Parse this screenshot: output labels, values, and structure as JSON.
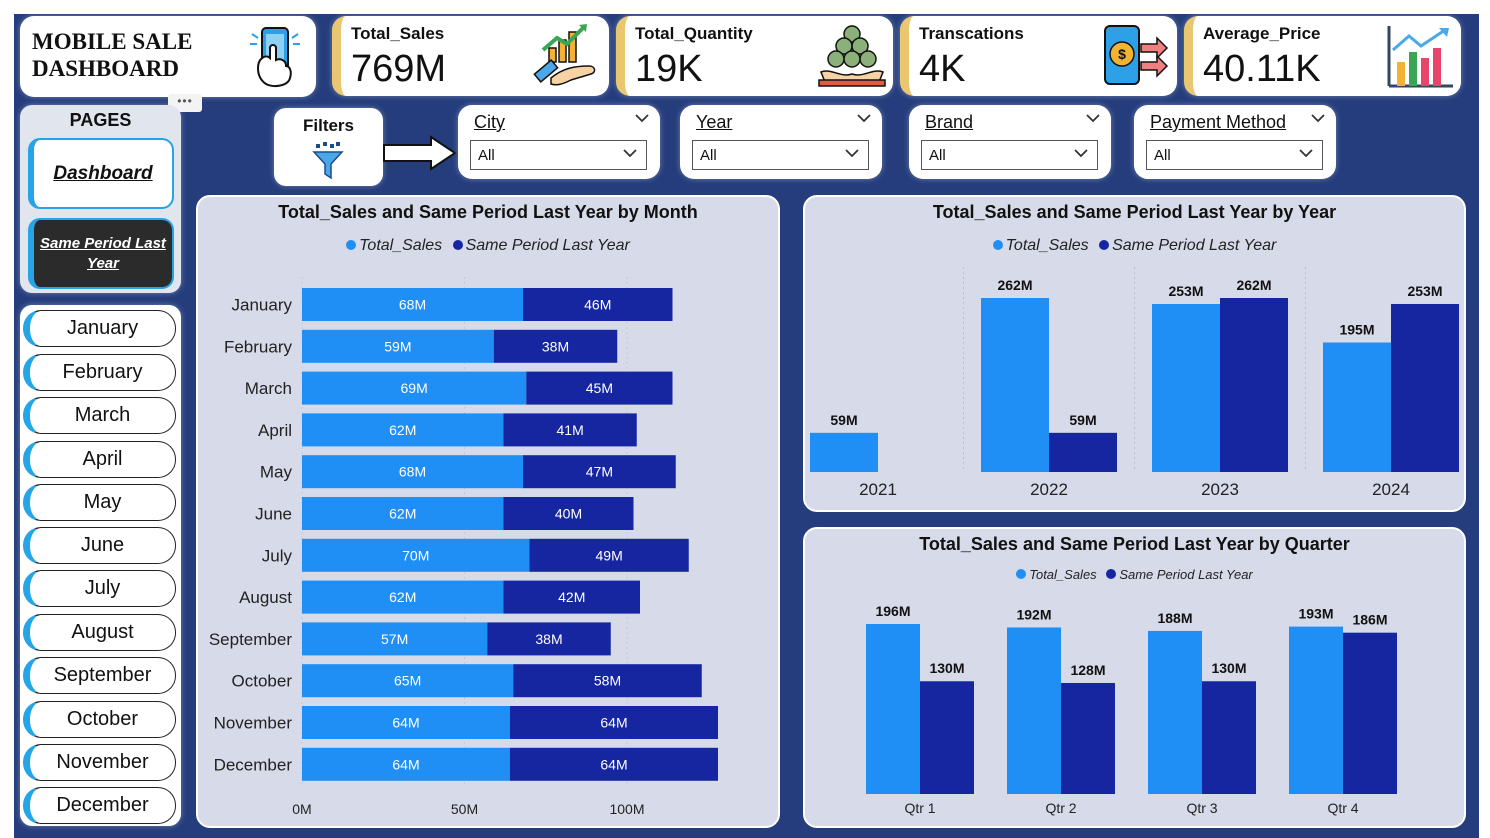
{
  "dashboard": {
    "title_line1": "MOBILE SALE",
    "title_line2": "DASHBOARD",
    "more_options": "•••"
  },
  "kpis": [
    {
      "label": "Total_Sales",
      "value": "769M",
      "icon": "money-growth-icon"
    },
    {
      "label": "Total_Quantity",
      "value": "19K",
      "icon": "coin-stack-icon"
    },
    {
      "label": "Transcations",
      "value": "4K",
      "icon": "phone-payment-icon"
    },
    {
      "label": "Average_Price",
      "value": "40.11K",
      "icon": "bar-chart-icon"
    }
  ],
  "pages": {
    "title": "PAGES",
    "dashboard_label": "Dashboard",
    "spl_label_line1": "Same Period Last",
    "spl_label_line2": "Year"
  },
  "months": [
    "January",
    "February",
    "March",
    "April",
    "May",
    "June",
    "July",
    "August",
    "September",
    "October",
    "November",
    "December"
  ],
  "filters": {
    "label": "Filters",
    "slicers": [
      {
        "label": "City",
        "value": "All"
      },
      {
        "label": "Year",
        "value": "All"
      },
      {
        "label": "Brand",
        "value": "All"
      },
      {
        "label": "Payment Method",
        "value": "All"
      }
    ]
  },
  "colors": {
    "background": "#253d7c",
    "panel": "#d7dbe9",
    "total_sales": "#1f8ff5",
    "same_period": "#1526a0",
    "accent": "#25a4e6",
    "kpi_border": "#e8c770"
  },
  "chart_data": [
    {
      "type": "bar",
      "orientation": "horizontal-stacked",
      "title": "Total_Sales and Same Period Last Year by Month",
      "categories": [
        "January",
        "February",
        "March",
        "April",
        "May",
        "June",
        "July",
        "August",
        "September",
        "October",
        "November",
        "December"
      ],
      "series": [
        {
          "name": "Total_Sales",
          "values": [
            68,
            59,
            69,
            62,
            68,
            62,
            70,
            62,
            57,
            65,
            64,
            64
          ],
          "labels": [
            "68M",
            "59M",
            "69M",
            "62M",
            "68M",
            "62M",
            "70M",
            "62M",
            "57M",
            "65M",
            "64M",
            "64M"
          ]
        },
        {
          "name": "Same Period Last Year",
          "values": [
            46,
            38,
            45,
            41,
            47,
            40,
            49,
            42,
            38,
            58,
            64,
            64
          ],
          "labels": [
            "46M",
            "38M",
            "45M",
            "41M",
            "47M",
            "40M",
            "49M",
            "42M",
            "38M",
            "58M",
            "64M",
            "64M"
          ]
        }
      ],
      "xticks": [
        "0M",
        "50M",
        "100M"
      ],
      "xlim": [
        0,
        135
      ],
      "legend": "top-center"
    },
    {
      "type": "bar",
      "orientation": "vertical-clustered",
      "title": "Total_Sales and Same Period Last Year by Year",
      "categories": [
        "2021",
        "2022",
        "2023",
        "2024"
      ],
      "series": [
        {
          "name": "Total_Sales",
          "values": [
            59,
            262,
            253,
            195
          ],
          "labels": [
            "59M",
            "262M",
            "253M",
            "195M"
          ]
        },
        {
          "name": "Same Period Last Year",
          "values": [
            null,
            59,
            262,
            253
          ],
          "labels": [
            "",
            "59M",
            "262M",
            "253M"
          ]
        }
      ],
      "ylim": [
        0,
        262
      ],
      "legend": "top-center"
    },
    {
      "type": "bar",
      "orientation": "vertical-clustered",
      "title": "Total_Sales and Same Period Last Year by Quarter",
      "categories": [
        "Qtr 1",
        "Qtr 2",
        "Qtr 3",
        "Qtr 4"
      ],
      "series": [
        {
          "name": "Total_Sales",
          "values": [
            196,
            192,
            188,
            193
          ],
          "labels": [
            "196M",
            "192M",
            "188M",
            "193M"
          ]
        },
        {
          "name": "Same Period Last Year",
          "values": [
            130,
            128,
            130,
            186
          ],
          "labels": [
            "130M",
            "128M",
            "130M",
            "186M"
          ]
        }
      ],
      "ylim": [
        0,
        196
      ],
      "legend": "top-center"
    }
  ]
}
